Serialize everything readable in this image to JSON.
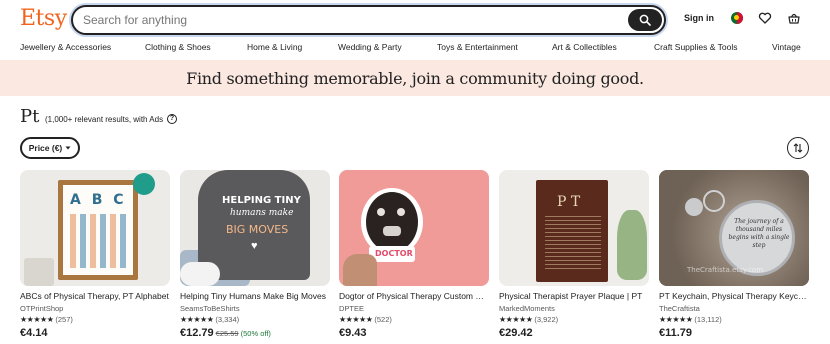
{
  "header": {
    "logo": "Etsy",
    "search_placeholder": "Search for anything",
    "signin_label": "Sign in"
  },
  "nav": {
    "items": [
      "Jewellery & Accessories",
      "Clothing & Shoes",
      "Home & Living",
      "Wedding & Party",
      "Toys & Entertainment",
      "Art & Collectibles",
      "Craft Supplies & Tools",
      "Vintage"
    ]
  },
  "banner": {
    "text": "Find something memorable, join a community doing good."
  },
  "search_results": {
    "query": "Pt",
    "count_text": "(1,000+ relevant results, with Ads",
    "help_symbol": "?",
    "price_filter_label": "Price (€)"
  },
  "listings": [
    {
      "title": "ABCs of Physical Therapy, PT Alphabet",
      "shop": "OTPrintShop",
      "stars": "★★★★★",
      "reviews": "(257)",
      "price": "€4.14",
      "image_text": "A B C"
    },
    {
      "title": "Helping Tiny Humans Make Big Moves",
      "shop": "SeamsToBeShirts",
      "stars": "★★★★★",
      "reviews": "(3,334)",
      "price": "€12.79",
      "original_price": "€25.59",
      "discount": "(50% off)",
      "image_line1": "HELPING TINY",
      "image_line2": "humans make",
      "image_line3": "BIG MOVES"
    },
    {
      "title": "Dogtor of Physical Therapy Custom Sticker",
      "shop": "DPTEE",
      "stars": "★★★★★",
      "reviews": "(522)",
      "price": "€9.43",
      "image_text": "DOCTOR"
    },
    {
      "title": "Physical Therapist Prayer Plaque | PT",
      "shop": "MarkedMoments",
      "stars": "★★★★★",
      "reviews": "(3,922)",
      "price": "€29.42",
      "image_text": "P T"
    },
    {
      "title": "PT Keychain, Physical Therapy Keychain",
      "shop": "TheCraftista",
      "stars": "★★★★★",
      "reviews": "(13,112)",
      "price": "€11.79",
      "image_text": "The journey of a thousand miles begins with a single step",
      "watermark": "TheCraftista.etsy.com"
    }
  ],
  "colors": {
    "brand": "#f1641e",
    "banner_bg": "#fae8e1",
    "discount": "#1b7a3a"
  },
  "icons": [
    "search-icon",
    "flag-icon",
    "heart-icon",
    "basket-icon",
    "chevron-down-icon",
    "sort-icon",
    "help-icon"
  ]
}
